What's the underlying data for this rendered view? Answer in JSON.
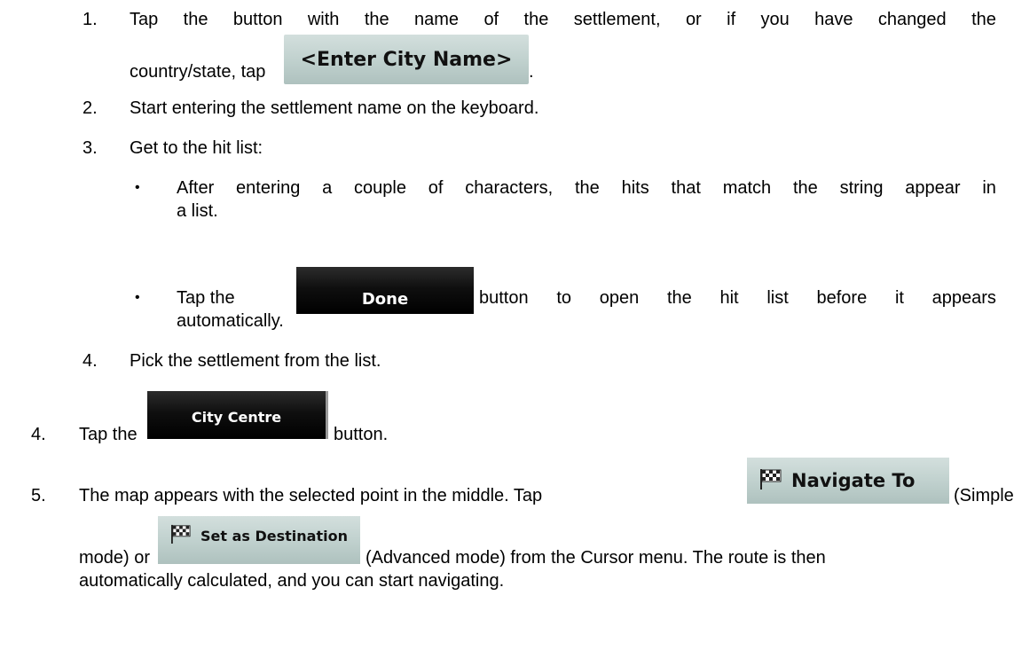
{
  "steps": {
    "s1_num": "1.",
    "s1_words": [
      "Tap",
      "the",
      "button",
      "with",
      "the",
      "name",
      "of",
      "the",
      "settlement,",
      "or",
      "if",
      "you",
      "have",
      "changed",
      "the"
    ],
    "s1_line2_prefix": "country/state, tap",
    "s1_line2_suffix": ".",
    "s2_num": "2.",
    "s2_text": "Start entering the settlement name on the keyboard.",
    "s3_num": "3.",
    "s3_text": "Get to the hit list:",
    "b1_line1_words": [
      "After",
      "entering",
      "a",
      "couple",
      "of",
      "characters,",
      "the",
      "hits",
      "that",
      "match",
      "the",
      "string",
      "appear",
      "in"
    ],
    "b1_line2": "a list.",
    "b2_prefix": "Tap the",
    "b2_suffix_words": [
      "button",
      "to",
      "open",
      "the",
      "hit",
      "list",
      "before",
      "it",
      "appears"
    ],
    "b2_line2": "automatically.",
    "s4_num": "4.",
    "s4_text": "Pick the settlement from the list.",
    "o4_num": "4.",
    "o4_prefix": "Tap the",
    "o4_suffix": "button.",
    "o5_num": "5.",
    "o5_prefix": "The map appears with the selected point in the middle. Tap",
    "o5_suffix": "(Simple",
    "o5_line2_prefix": "mode) or",
    "o5_line2_suffix": "(Advanced mode) from the Cursor menu. The route is then",
    "o5_line3": "automatically calculated, and you can start navigating."
  },
  "buttons": {
    "enter_city": "<Enter City Name>",
    "done": "Done",
    "city_centre": "City Centre",
    "navigate_to": "Navigate To",
    "set_destination": "Set as Destination"
  },
  "bullet_char": "•"
}
